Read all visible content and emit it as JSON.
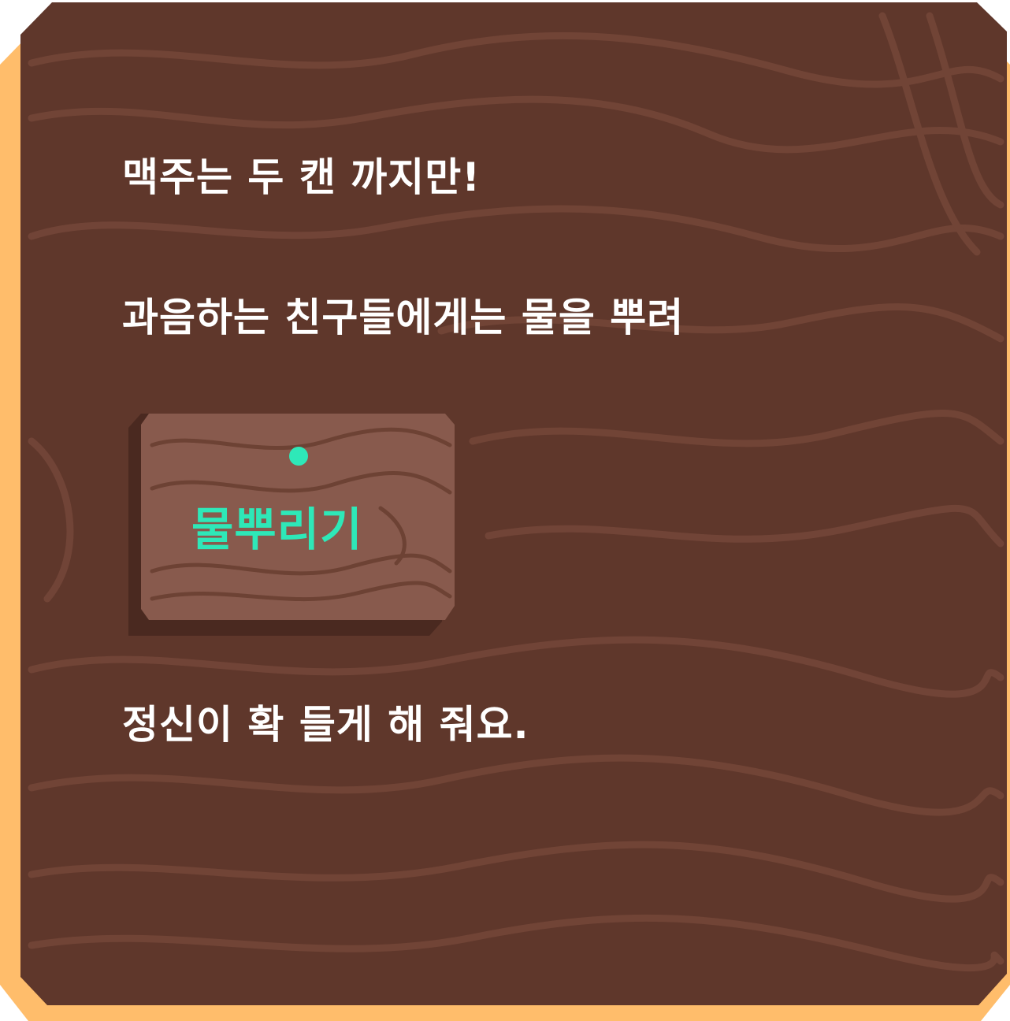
{
  "colors": {
    "board": "#5f372b",
    "board_grain": "#734638",
    "edge": "#ffbd6b",
    "sign_face": "#885a4d",
    "sign_shadow": "#4a2920",
    "accent": "#2ee8b8",
    "text": "#ffffff"
  },
  "text": {
    "line_1": "맥주는 두 캔 까지만!",
    "line_2": "과음하는 친구들에게는 물을 뿌려",
    "line_3": "정신이 확 들게 해 줘요."
  },
  "sign": {
    "label": "물뿌리기",
    "icon": "pin-dot-icon"
  }
}
